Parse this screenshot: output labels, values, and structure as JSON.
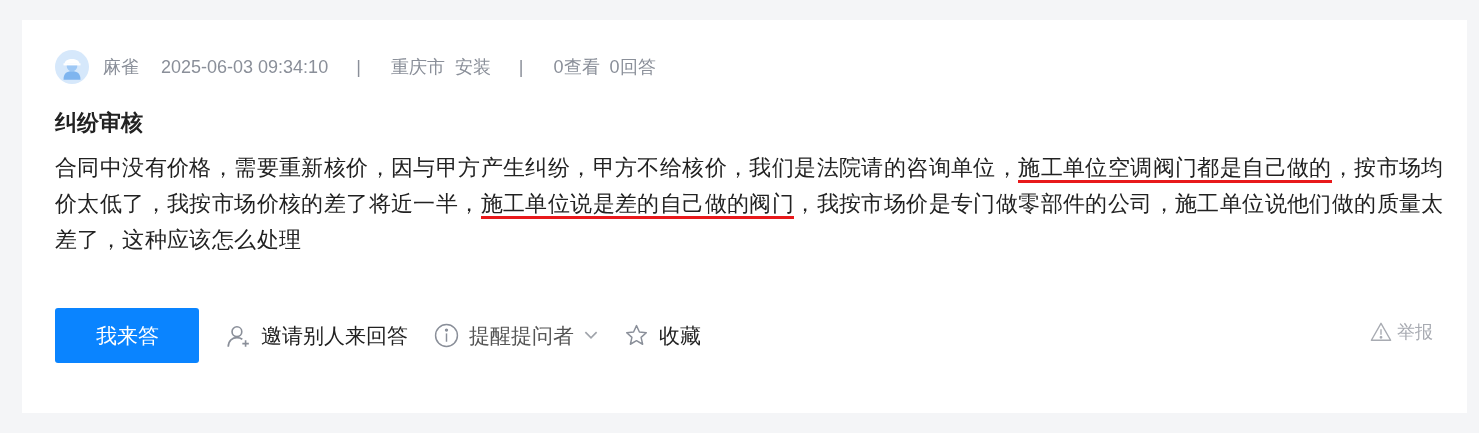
{
  "author": {
    "name": "麻雀",
    "time": "2025-06-03 09:34:10"
  },
  "separators": [
    "|",
    "|"
  ],
  "location": {
    "city": "重庆市",
    "category": "安装"
  },
  "stats": {
    "views": "0查看",
    "answers": "0回答"
  },
  "question": {
    "title": "纠纷审核",
    "segments": [
      {
        "text": "合同中没有价格，需要重新核价，因与甲方产生纠纷，甲方不给核价，我们是法院请的咨询单位，",
        "marked": false
      },
      {
        "text": "施工单位空调阀门都是自己做的",
        "marked": true
      },
      {
        "text": "，按市场均价太低了，我按市场价核的差了将近一半，",
        "marked": false
      },
      {
        "text": "施工单位说是差的自己做的阀门",
        "marked": true
      },
      {
        "text": "，我按市场价是专门做零部件的公司，施工单位说他们做的质量太差了，这种应该怎么处理",
        "marked": false
      }
    ]
  },
  "actions": [
    {
      "kind": "primary",
      "label": "我来答"
    },
    {
      "kind": "invite",
      "label": "邀请别人来回答"
    },
    {
      "kind": "remind",
      "label": "提醒提问者"
    },
    {
      "kind": "favorite",
      "label": "收藏"
    }
  ],
  "report": {
    "label": "举报"
  }
}
